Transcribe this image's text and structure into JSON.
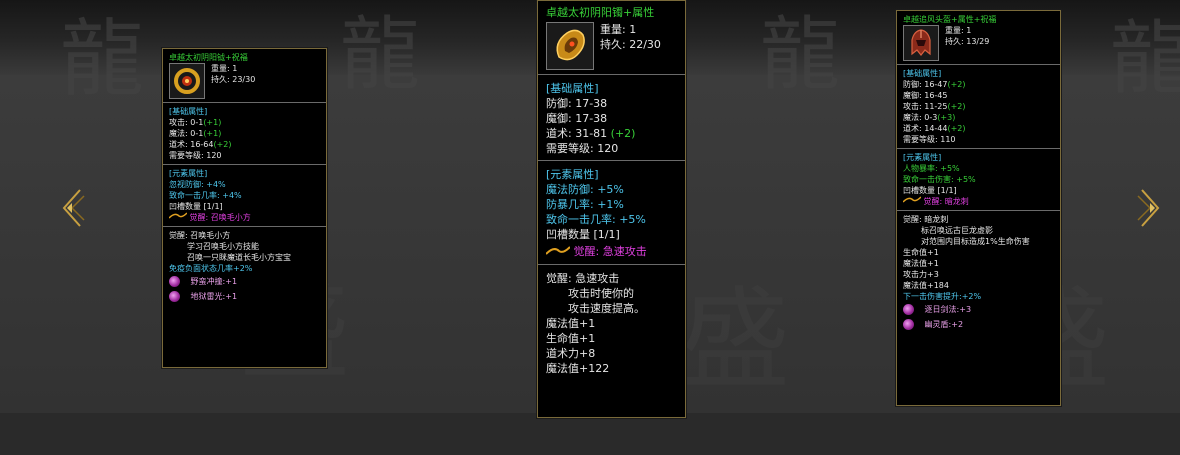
{
  "colors": {
    "title": "#38d038",
    "section": "#4ec6ec",
    "bonus": "#38d038",
    "awaken": "#e040e0",
    "border": "#7a6a3a"
  },
  "nav": {
    "prev_icon": "chevron-left-icon",
    "next_icon": "chevron-right-icon"
  },
  "cards": [
    {
      "name": "卓越太初阴阳钺+祝福",
      "weight": "重量: 1",
      "durability": "持久: 23/30",
      "item_icon": "gold-ring-item-icon",
      "base_header": "[基础属性]",
      "base": [
        {
          "text": "攻击: 0-1",
          "bonus": "(+1)"
        },
        {
          "text": "魔法: 0-1",
          "bonus": "(+1)"
        },
        {
          "text": "道术: 16-64",
          "bonus": "(+2)"
        },
        {
          "text": "需要等级: 120",
          "bonus": ""
        }
      ],
      "elem_header": "[元素属性]",
      "elem": [
        "忽视防御: +4%",
        "致命一击几率: +4%"
      ],
      "slots": "凹槽数量 [1/1]",
      "awaken_tag": "觉醒: 召唤毛小方",
      "awaken_lines": [
        "觉醒: 召唤毛小方",
        "学习召唤毛小方技能",
        "召唤一只眯魔道长毛小方宝宝"
      ],
      "extra_cyan": [
        "免疫负面状态几率+2%"
      ],
      "extra_white": [],
      "gems": [
        "野蛮冲撞:+1",
        "地狱雷光:+1"
      ]
    },
    {
      "name": "卓越太初阴阳镯+属性",
      "weight": "重量: 1",
      "durability": "持久: 22/30",
      "item_icon": "gold-bracelet-item-icon",
      "base_header": "[基础属性]",
      "base": [
        {
          "text": "防御: 17-38",
          "bonus": ""
        },
        {
          "text": "魔御: 17-38",
          "bonus": ""
        },
        {
          "text": "道术: 31-81",
          "bonus": "(+2)"
        },
        {
          "text": "需要等级: 120",
          "bonus": ""
        }
      ],
      "elem_header": "[元素属性]",
      "elem": [
        "魔法防御: +5%",
        "防暴几率: +1%",
        "致命一击几率: +5%"
      ],
      "slots": "凹槽数量 [1/1]",
      "awaken_tag": "觉醒: 急速攻击",
      "awaken_lines": [
        "觉醒: 急速攻击",
        "攻击时使你的",
        "攻击速度提高。"
      ],
      "extra_cyan": [],
      "extra_white": [
        "魔法值+1",
        "生命值+1",
        "道术力+8",
        "魔法值+122"
      ],
      "gems": []
    },
    {
      "name": "卓越追风头盔+属性+祝福",
      "weight": "重量: 1",
      "durability": "持久: 13/29",
      "item_icon": "red-helmet-item-icon",
      "base_header": "[基础属性]",
      "base": [
        {
          "text": "防御: 16-47",
          "bonus": "(+2)"
        },
        {
          "text": "魔御: 16-45",
          "bonus": ""
        },
        {
          "text": "攻击: 11-25",
          "bonus": "(+2)"
        },
        {
          "text": "魔法: 0-3",
          "bonus": "(+3)"
        },
        {
          "text": "道术: 14-44",
          "bonus": "(+2)"
        },
        {
          "text": "需要等级: 110",
          "bonus": ""
        }
      ],
      "elem_header": "[元素属性]",
      "elem": [
        "人物暴率: +5%",
        "致命一击伤害: +5%"
      ],
      "slots": "凹槽数量 [1/1]",
      "awaken_tag": "觉醒: 暗龙刺",
      "awaken_lines": [
        "觉醒: 暗龙刺",
        "标召唤远古巨龙虚影",
        "对范围内目标造成1%生命伤害"
      ],
      "extra_cyan": [],
      "extra_white": [
        "生命值+1",
        "魔法值+1",
        "攻击力+3",
        "魔法值+184"
      ],
      "extra_cyan2": [
        "下一击伤害提升:+2%"
      ],
      "gems": [
        "逐日剑法:+3",
        "幽灵盾:+2"
      ]
    }
  ]
}
